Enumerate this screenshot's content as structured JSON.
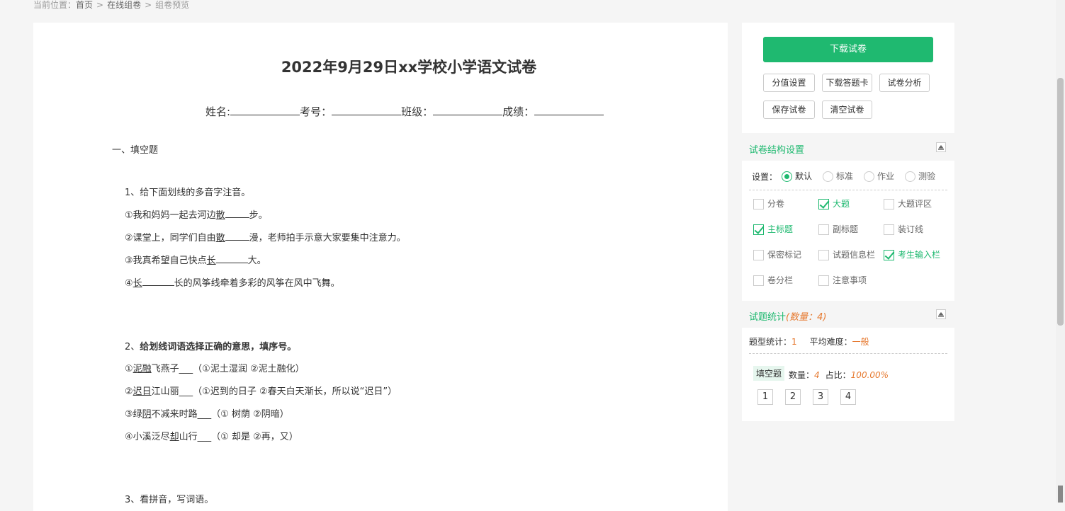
{
  "breadcrumb": {
    "prefix": "当前位置：",
    "items": [
      "首页",
      "在线组卷",
      "组卷预览"
    ],
    "separator": ">"
  },
  "paper": {
    "title": "2022年9月29日xx学校小学语文试卷",
    "fields": [
      "姓名:",
      "考号：",
      "班级：",
      "成绩："
    ],
    "section": "一、填空题",
    "q1": {
      "stem": "1、给下面划线的多音字注音。",
      "items": [
        {
          "a": "①我和妈妈一起去河边",
          "u": "散",
          "b": "步。"
        },
        {
          "a": "②课堂上，同学们自由",
          "u": "散",
          "b": "漫，老师拍手示意大家要集中注意力。"
        },
        {
          "a": "③我真希望自己快点",
          "u": "长",
          "b": "大。"
        },
        {
          "a": "④",
          "u": "长",
          "b": "长的风筝线牵着多彩的风筝在风中飞舞。"
        }
      ]
    },
    "q2": {
      "num": "2、",
      "stem": "给划线词语选择正确的意思，填序号。",
      "items": [
        {
          "a": "①",
          "u": "泥融",
          "b": "飞燕子___（①泥土湿润 ②泥土融化）"
        },
        {
          "a": "②",
          "u": "迟日",
          "b": "江山丽___（①迟到的日子 ②春天白天渐长，所以说“迟日”）"
        },
        {
          "a": "③绿",
          "u": "阴",
          "b": "不减来时路___（① 树荫 ②阴暗）"
        },
        {
          "a": "④小溪泛尽",
          "u": "却",
          "b": "山行___（① 却是 ②再，又）"
        }
      ]
    },
    "q3": {
      "stem": "3、看拼音，写词语。"
    }
  },
  "actions": {
    "download": "下载试卷",
    "buttons": [
      "分值设置",
      "下载答题卡",
      "试卷分析",
      "保存试卷",
      "清空试卷"
    ]
  },
  "structure": {
    "title": "试卷结构设置",
    "setting_label": "设置：",
    "radios": [
      {
        "label": "默认",
        "checked": true
      },
      {
        "label": "标准",
        "checked": false
      },
      {
        "label": "作业",
        "checked": false
      },
      {
        "label": "测验",
        "checked": false
      }
    ],
    "checks": [
      {
        "label": "分卷",
        "checked": false
      },
      {
        "label": "大题",
        "checked": true
      },
      {
        "label": "大题评区",
        "checked": false
      },
      {
        "label": "主标题",
        "checked": true
      },
      {
        "label": "副标题",
        "checked": false
      },
      {
        "label": "装订线",
        "checked": false
      },
      {
        "label": "保密标记",
        "checked": false
      },
      {
        "label": "试题信息栏",
        "checked": false
      },
      {
        "label": "考生输入栏",
        "checked": true
      },
      {
        "label": "卷分栏",
        "checked": false
      },
      {
        "label": "注意事项",
        "checked": false
      }
    ]
  },
  "stats": {
    "title": "试题统计",
    "count_text": "(数量：4)",
    "type_label": "题型统计：",
    "type_value": "1",
    "difficulty_label": "平均难度：",
    "difficulty_value": "一般",
    "tag": "填空题",
    "qty_label": "数量：",
    "qty_value": "4",
    "ratio_label": "占比：",
    "ratio_value": "100.00%",
    "numbers": [
      "1",
      "2",
      "3",
      "4"
    ]
  },
  "colors": {
    "accent": "#1fb970",
    "highlight": "#e6792f"
  }
}
